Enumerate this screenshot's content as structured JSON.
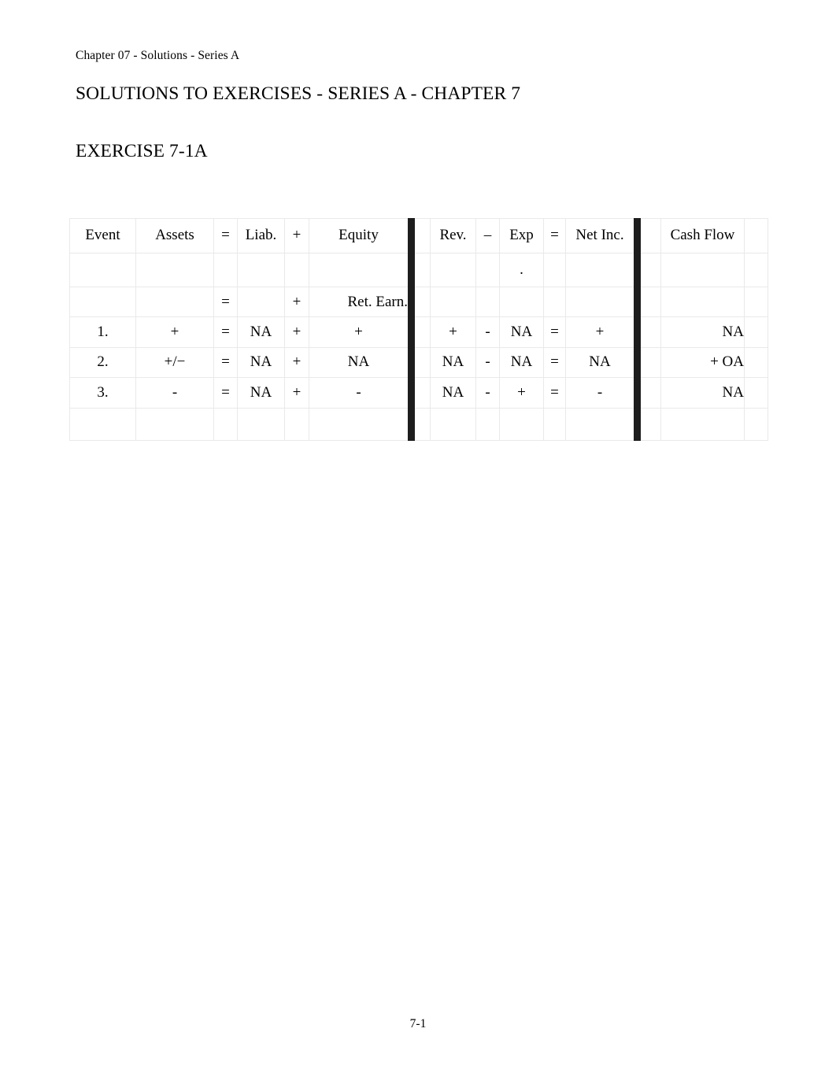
{
  "document": {
    "running_head": "Chapter 07 - Solutions - Series A",
    "title": "SOLUTIONS TO EXERCISES - SERIES A - CHAPTER 7",
    "exercise_title": "EXERCISE 7-1A",
    "page_number": "7-1"
  },
  "table": {
    "header": {
      "event": "Event",
      "assets": "Assets",
      "equals1": "=",
      "liabilities": "Liab.",
      "plus1": "+",
      "equity": "Equity",
      "revenue": "Rev.",
      "minus": "–",
      "expense": "Exp",
      "expense_dot": ".",
      "equals2": "=",
      "net_income": "Net Inc.",
      "cash_flow": "Cash Flow"
    },
    "subheader": {
      "equals1": "=",
      "plus1": "+",
      "retained_earnings": "Ret. Earn."
    },
    "rows": [
      {
        "event": "1.",
        "assets": "+",
        "equals1": "=",
        "liabilities": "NA",
        "plus1": "+",
        "equity": "+",
        "revenue": "+",
        "minus": "-",
        "expense": "NA",
        "equals2": "=",
        "net_income": "+",
        "cash_flow": "NA"
      },
      {
        "event": "2.",
        "assets": "+/−",
        "equals1": "=",
        "liabilities": "NA",
        "plus1": "+",
        "equity": "NA",
        "revenue": "NA",
        "minus": "-",
        "expense": "NA",
        "equals2": "=",
        "net_income": "NA",
        "cash_flow": "+ OA"
      },
      {
        "event": "3.",
        "assets": "-",
        "equals1": "=",
        "liabilities": "NA",
        "plus1": "+",
        "equity": "-",
        "revenue": "NA",
        "minus": "-",
        "expense": "+",
        "equals2": "=",
        "net_income": "-",
        "cash_flow": "NA"
      }
    ]
  },
  "style": {
    "separator_color": "#1d1d1d",
    "gridline_color": "#e9e9e9",
    "text_color": "#000000"
  }
}
